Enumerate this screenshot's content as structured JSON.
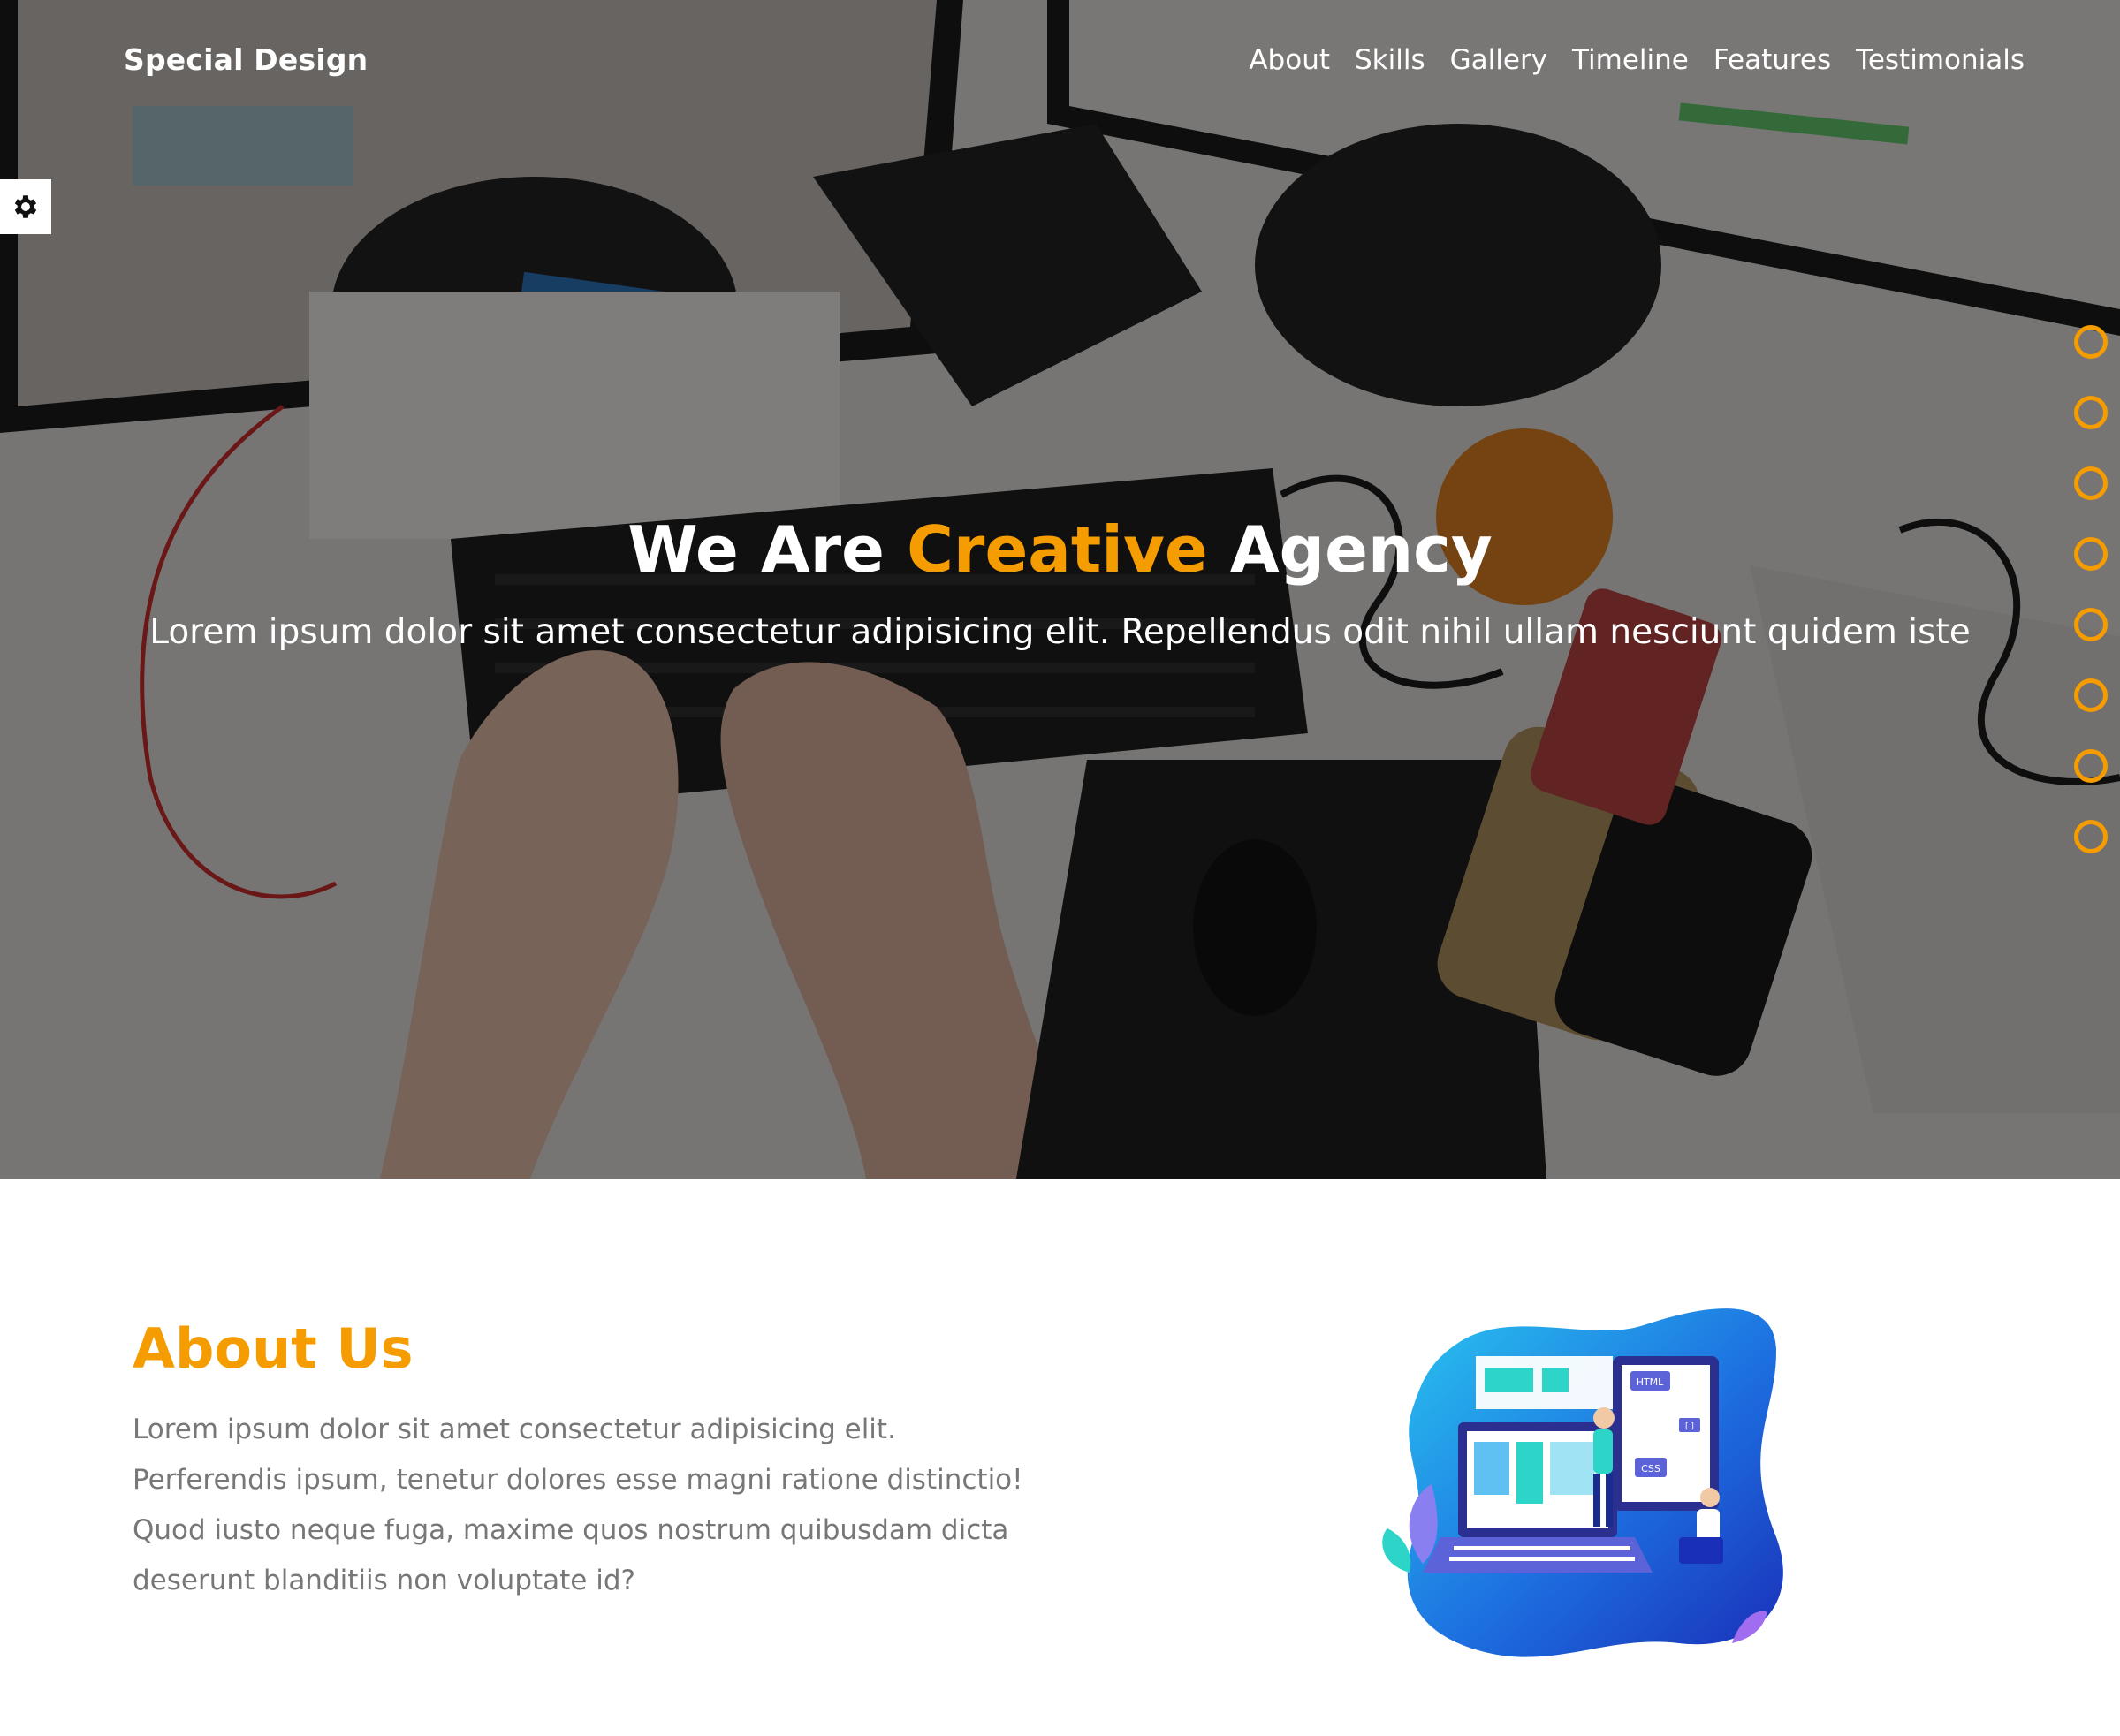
{
  "header": {
    "logo": "Special Design",
    "nav": [
      "About",
      "Skills",
      "Gallery",
      "Timeline",
      "Features",
      "Testimonials"
    ]
  },
  "settings": {
    "icon": "gear-icon"
  },
  "bullets": {
    "count": 8,
    "color": "#f59c00"
  },
  "hero": {
    "title_before": "We Are",
    "title_accent": "Creative",
    "title_after": "Agency",
    "subtitle": "Lorem ipsum dolor sit amet consectetur adipisicing elit. Repellendus odit nihil ullam nesciunt quidem iste"
  },
  "about": {
    "title": "About Us",
    "text": "Lorem ipsum dolor sit amet consectetur adipisicing elit. Perferendis ipsum, tenetur dolores esse magni ratione distinctio! Quod iusto neque fuga, maxime quos nostrum quibusdam dicta deserunt blanditiis non voluptate id?",
    "illustration_labels": [
      "HTML",
      "CSS",
      "[ ]"
    ]
  },
  "colors": {
    "accent": "#f59c00",
    "overlay": "rgba(0,0,0,0.45)",
    "about_text": "#777777"
  }
}
